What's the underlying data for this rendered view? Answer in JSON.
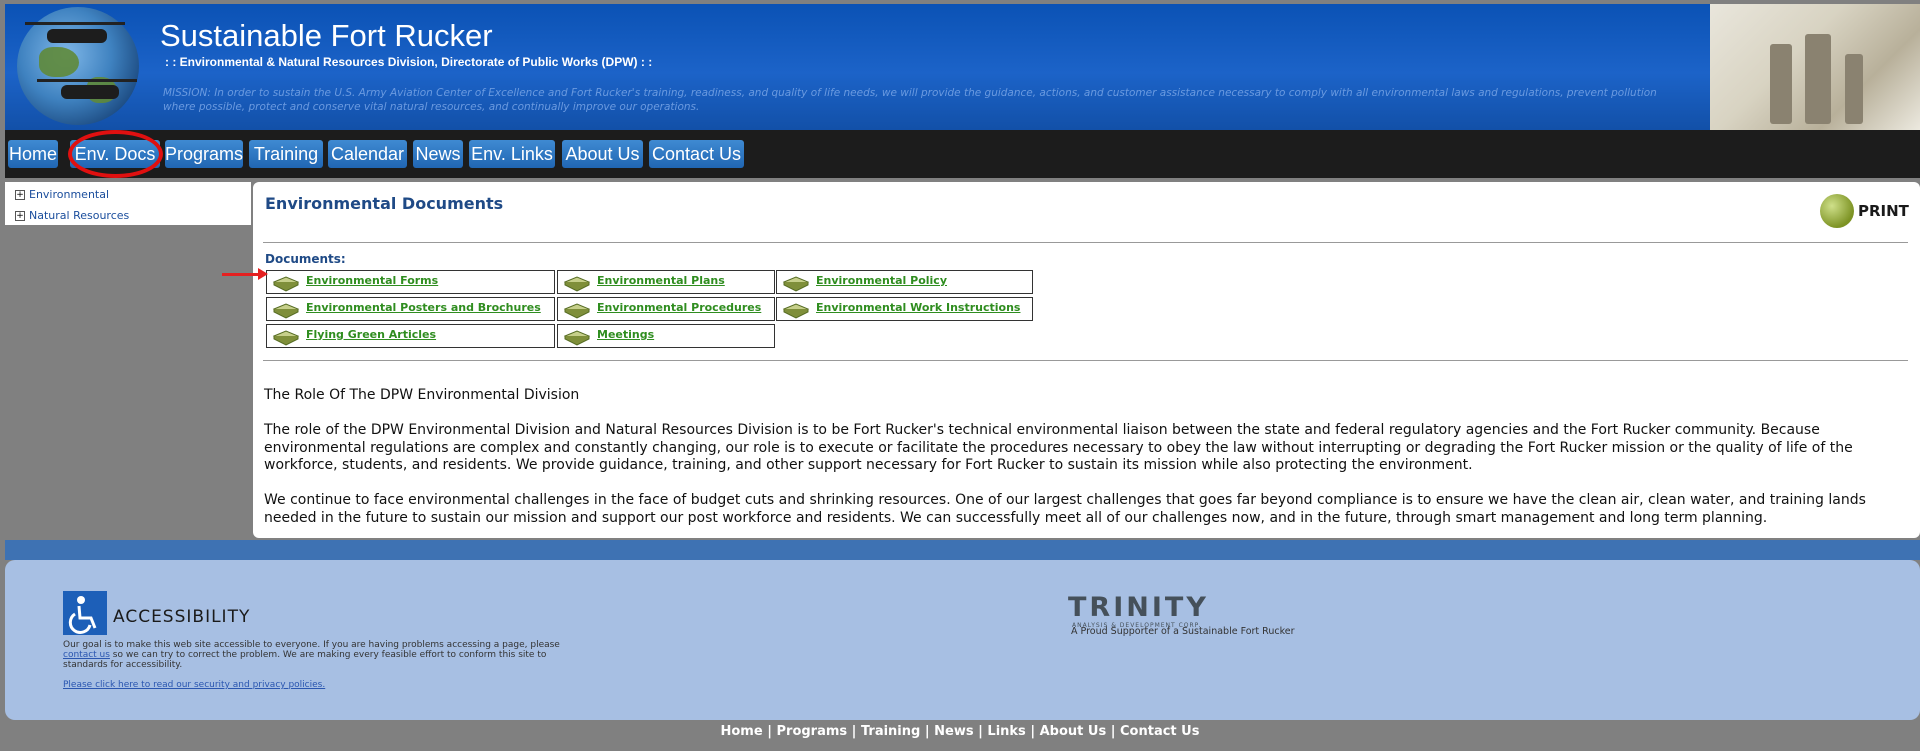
{
  "header": {
    "title": "Sustainable Fort Rucker",
    "subtitle": ": : Environmental & Natural Resources Division, Directorate of Public Works (DPW) : :",
    "mission": "MISSION: In order to sustain the U.S. Army Aviation Center of Excellence and Fort Rucker's training, readiness, and quality of life needs, we will provide the guidance, actions, and customer assistance necessary to comply with all environmental laws and regulations, prevent pollution where possible, protect and conserve vital natural resources, and continually improve our operations."
  },
  "nav": {
    "tabs": [
      "Home",
      "Env. Docs",
      "Programs",
      "Training",
      "Calendar",
      "News",
      "Env. Links",
      "About Us",
      "Contact Us"
    ],
    "active": "Env. Docs"
  },
  "sidebar": {
    "items": [
      "Environmental",
      "Natural Resources"
    ]
  },
  "main": {
    "heading": "Environmental Documents",
    "print_label": "PRINT",
    "documents_label": "Documents:",
    "documents": [
      "Environmental Forms",
      "Environmental Plans",
      "Environmental Policy",
      "Environmental Posters and Brochures",
      "Environmental Procedures",
      "Environmental Work Instructions",
      "Flying Green Articles",
      "Meetings"
    ],
    "role_heading": "The Role Of The DPW Environmental Division",
    "paragraph1": "The role of the DPW Environmental Division and Natural Resources Division is to be Fort Rucker's technical environmental liaison between the state and federal regulatory agencies and the Fort Rucker community. Because environmental regulations are complex and constantly changing, our role is to execute or facilitate the procedures necessary to obey the law without interrupting or degrading the Fort Rucker mission or the quality of life of the workforce, students, and residents. We provide guidance, training, and other support necessary for Fort Rucker to sustain its mission while also protecting the environment.",
    "paragraph2": "We continue to face environmental challenges in the face of budget cuts and shrinking resources. One of our largest challenges that goes far beyond compliance is to ensure we have the clean air, clean water, and training lands needed in the future to sustain our mission and support our post workforce and residents. We can successfully meet all of our challenges now, and in the future, through smart management and long term planning."
  },
  "footer": {
    "accessibility_title": "ACCESSIBILITY",
    "accessibility_text_before": "Our goal is to make this web site accessible to everyone. If you are having problems accessing a page, please ",
    "accessibility_link": "contact us",
    "accessibility_text_after": " so we can try to correct the problem. We are making every feasible effort to conform this site to standards for accessibility.",
    "privacy_link": "Please click here to read our security and privacy policies.",
    "trinity_name": "TRINITY",
    "trinity_sub": "ANALYSIS & DEVELOPMENT CORP.",
    "trinity_tagline": "A Proud Supporter of a Sustainable Fort Rucker"
  },
  "bottom_links": [
    "Home",
    "Programs",
    "Training",
    "News",
    "Links",
    "About Us",
    "Contact Us"
  ],
  "colors": {
    "header_blue": "#1c63c8",
    "nav_bg": "#1c1c1c",
    "tab_blue": "#2f78c4",
    "link_green": "#2f8d1f",
    "heading_blue": "#1f4a86",
    "highlight_red": "#e01010"
  }
}
